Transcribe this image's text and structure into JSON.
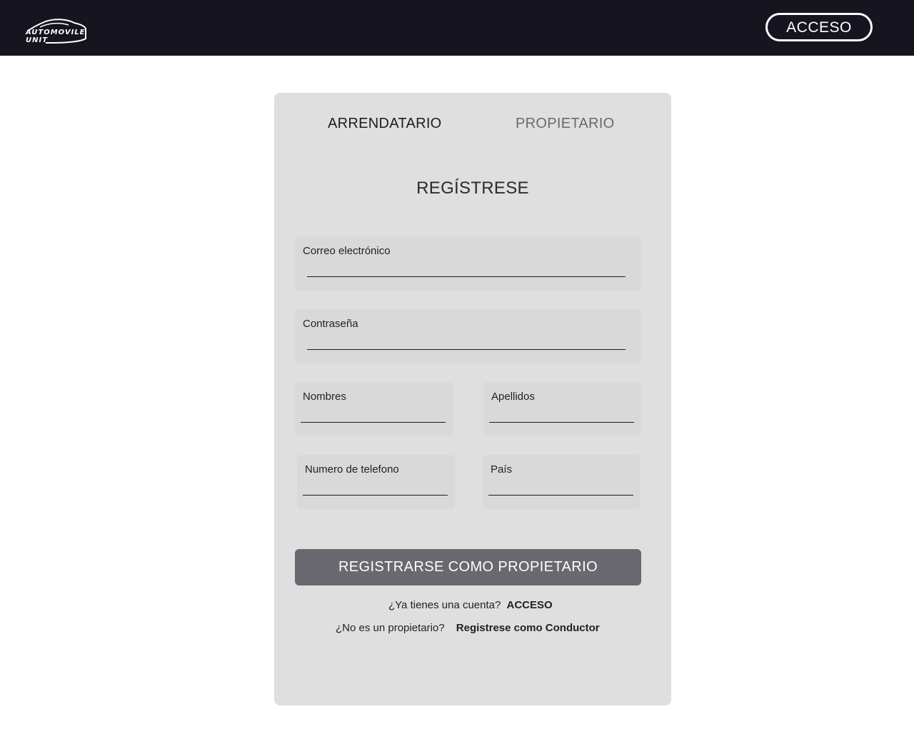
{
  "header": {
    "logo": {
      "line1": "AUTOMOVILE",
      "line2": "UNIT",
      "icon": "car-icon"
    },
    "login_label": "ACCESO"
  },
  "card": {
    "tabs": [
      {
        "label": "ARRENDATARIO",
        "active": true
      },
      {
        "label": "PROPIETARIO",
        "active": false
      }
    ],
    "title": "REGÍSTRESE",
    "fields": {
      "email": {
        "label": "Correo electrónico",
        "value": ""
      },
      "password": {
        "label": "Contraseña",
        "value": ""
      },
      "first_name": {
        "label": "Nombres",
        "value": ""
      },
      "last_name": {
        "label": "Apellidos",
        "value": ""
      },
      "phone": {
        "label": "Numero de telefono",
        "value": ""
      },
      "country": {
        "label": "País",
        "value": ""
      }
    },
    "submit_label": "REGISTRARSE COMO  PROPIETARIO",
    "have_account": {
      "text": "¿Ya tienes una cuenta?",
      "link": "ACCESO"
    },
    "not_owner": {
      "text": "¿No  es un propietario?",
      "link": "Registrese como Conductor"
    }
  },
  "colors": {
    "topbar": "#15141f",
    "card": "#dfdfdf",
    "field": "#d9d9d9",
    "button": "#6a6970"
  }
}
